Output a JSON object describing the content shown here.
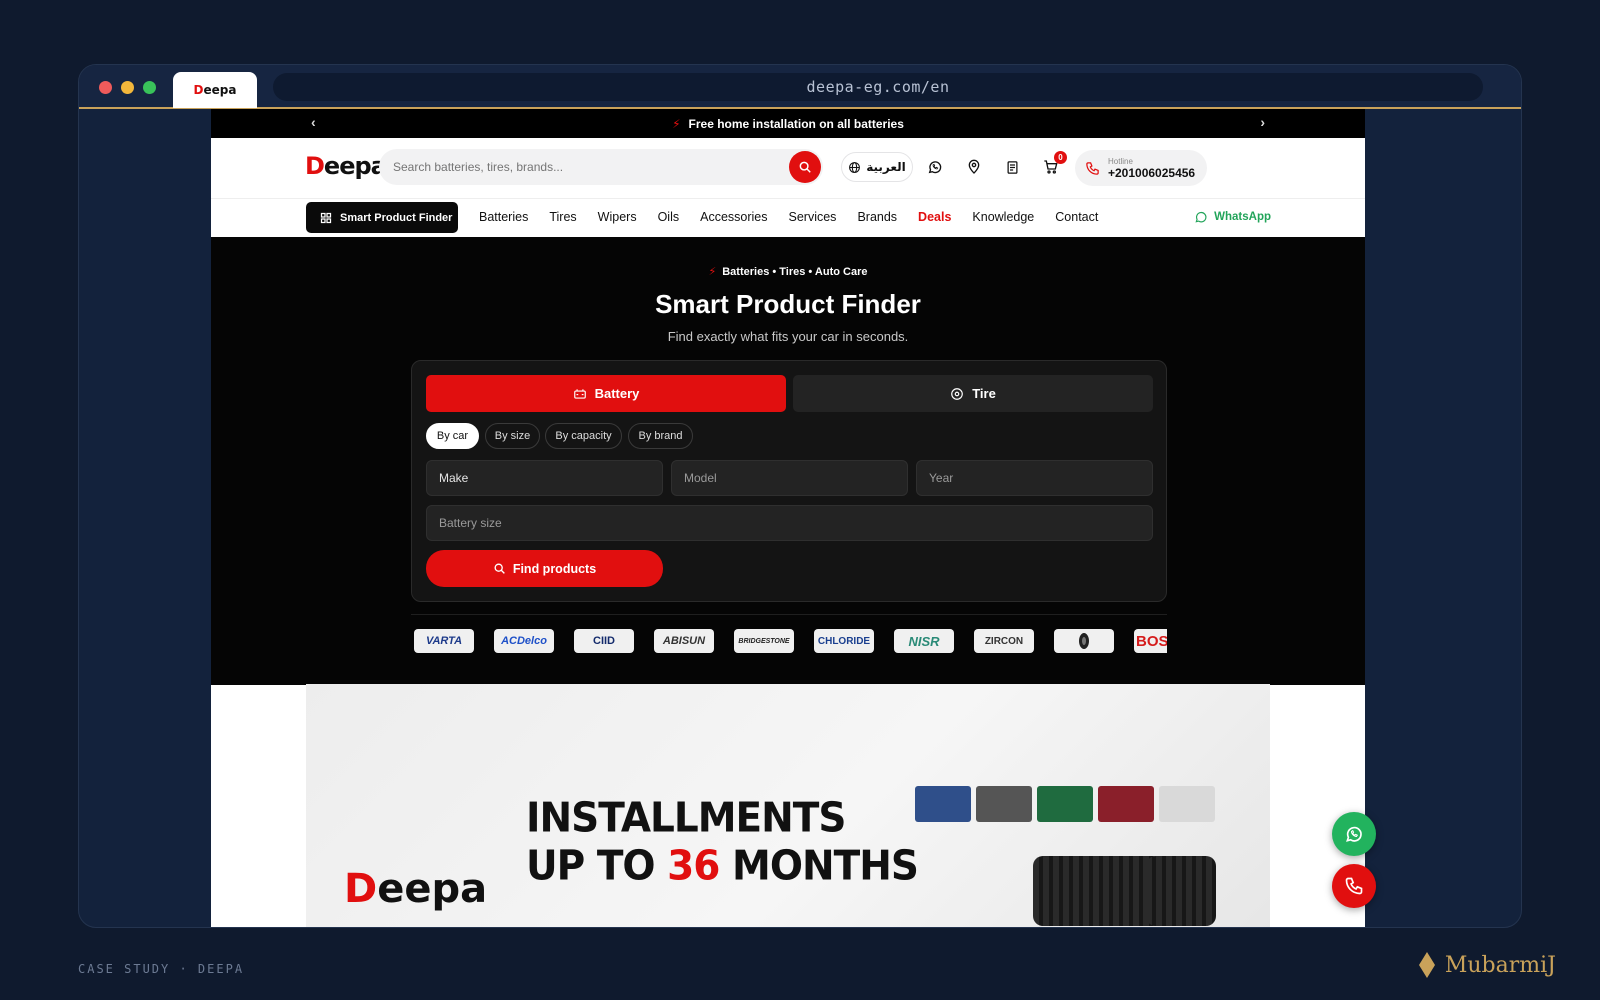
{
  "browser": {
    "tab_title": "Deepa",
    "url": "deepa-eg.com/en"
  },
  "announcement": {
    "text": "Free home installation on all batteries"
  },
  "header": {
    "logo_initial": "D",
    "logo_rest": "eepa",
    "search_placeholder": "Search batteries, tires, brands...",
    "language": "العربية",
    "cart_count": "0",
    "hotline_label": "Hotline",
    "hotline_number": "+201006025456"
  },
  "nav": {
    "finder_button": "Smart Product Finder",
    "links": [
      "Batteries",
      "Tires",
      "Wipers",
      "Oils",
      "Accessories",
      "Services",
      "Brands",
      "Deals",
      "Knowledge",
      "Contact"
    ],
    "whatsapp": "WhatsApp"
  },
  "hero": {
    "eyebrow": "Batteries • Tires • Auto Care",
    "title": "Smart Product Finder",
    "subtitle": "Find exactly what fits your car in seconds.",
    "tabs": {
      "battery": "Battery",
      "tire": "Tire"
    },
    "chips": [
      "By car",
      "By size",
      "By capacity",
      "By brand"
    ],
    "fields": {
      "make": "Make",
      "model": "Model",
      "year": "Year",
      "battery_size": "Battery size"
    },
    "find_button": "Find products"
  },
  "brands": [
    "VARTA",
    "ACDelco",
    "CIID",
    "ABISUN",
    "BRIDGESTONE",
    "CHLORIDE",
    "NISR",
    "ZIRCON",
    "",
    "BOS"
  ],
  "banner": {
    "line1": "INSTALLMENTS",
    "line2_prefix": "UP TO ",
    "line2_highlight": "36",
    "line2_suffix": " MONTHS",
    "logo_initial": "D",
    "logo_rest": "eepa"
  },
  "footer": {
    "case_study": "CASE STUDY · DEEPA",
    "signature": "MubarmiJ"
  },
  "colors": {
    "brand_red": "#e10f0f",
    "whatsapp_green": "#22b35e",
    "page_bg": "#0f1a2e",
    "accent_gold": "#c9a25a"
  }
}
